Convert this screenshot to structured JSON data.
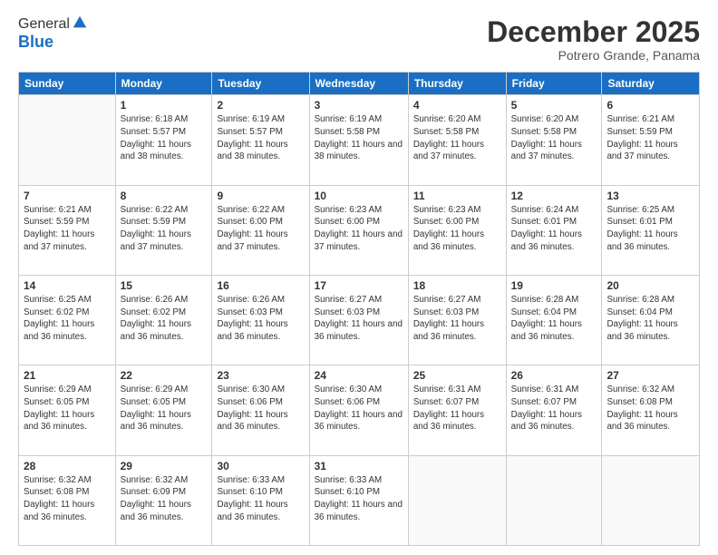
{
  "logo": {
    "general": "General",
    "blue": "Blue"
  },
  "header": {
    "month": "December 2025",
    "location": "Potrero Grande, Panama"
  },
  "days_of_week": [
    "Sunday",
    "Monday",
    "Tuesday",
    "Wednesday",
    "Thursday",
    "Friday",
    "Saturday"
  ],
  "weeks": [
    [
      {
        "day": "",
        "sunrise": "",
        "sunset": "",
        "daylight": ""
      },
      {
        "day": "1",
        "sunrise": "Sunrise: 6:18 AM",
        "sunset": "Sunset: 5:57 PM",
        "daylight": "Daylight: 11 hours and 38 minutes."
      },
      {
        "day": "2",
        "sunrise": "Sunrise: 6:19 AM",
        "sunset": "Sunset: 5:57 PM",
        "daylight": "Daylight: 11 hours and 38 minutes."
      },
      {
        "day": "3",
        "sunrise": "Sunrise: 6:19 AM",
        "sunset": "Sunset: 5:58 PM",
        "daylight": "Daylight: 11 hours and 38 minutes."
      },
      {
        "day": "4",
        "sunrise": "Sunrise: 6:20 AM",
        "sunset": "Sunset: 5:58 PM",
        "daylight": "Daylight: 11 hours and 37 minutes."
      },
      {
        "day": "5",
        "sunrise": "Sunrise: 6:20 AM",
        "sunset": "Sunset: 5:58 PM",
        "daylight": "Daylight: 11 hours and 37 minutes."
      },
      {
        "day": "6",
        "sunrise": "Sunrise: 6:21 AM",
        "sunset": "Sunset: 5:59 PM",
        "daylight": "Daylight: 11 hours and 37 minutes."
      }
    ],
    [
      {
        "day": "7",
        "sunrise": "Sunrise: 6:21 AM",
        "sunset": "Sunset: 5:59 PM",
        "daylight": "Daylight: 11 hours and 37 minutes."
      },
      {
        "day": "8",
        "sunrise": "Sunrise: 6:22 AM",
        "sunset": "Sunset: 5:59 PM",
        "daylight": "Daylight: 11 hours and 37 minutes."
      },
      {
        "day": "9",
        "sunrise": "Sunrise: 6:22 AM",
        "sunset": "Sunset: 6:00 PM",
        "daylight": "Daylight: 11 hours and 37 minutes."
      },
      {
        "day": "10",
        "sunrise": "Sunrise: 6:23 AM",
        "sunset": "Sunset: 6:00 PM",
        "daylight": "Daylight: 11 hours and 37 minutes."
      },
      {
        "day": "11",
        "sunrise": "Sunrise: 6:23 AM",
        "sunset": "Sunset: 6:00 PM",
        "daylight": "Daylight: 11 hours and 36 minutes."
      },
      {
        "day": "12",
        "sunrise": "Sunrise: 6:24 AM",
        "sunset": "Sunset: 6:01 PM",
        "daylight": "Daylight: 11 hours and 36 minutes."
      },
      {
        "day": "13",
        "sunrise": "Sunrise: 6:25 AM",
        "sunset": "Sunset: 6:01 PM",
        "daylight": "Daylight: 11 hours and 36 minutes."
      }
    ],
    [
      {
        "day": "14",
        "sunrise": "Sunrise: 6:25 AM",
        "sunset": "Sunset: 6:02 PM",
        "daylight": "Daylight: 11 hours and 36 minutes."
      },
      {
        "day": "15",
        "sunrise": "Sunrise: 6:26 AM",
        "sunset": "Sunset: 6:02 PM",
        "daylight": "Daylight: 11 hours and 36 minutes."
      },
      {
        "day": "16",
        "sunrise": "Sunrise: 6:26 AM",
        "sunset": "Sunset: 6:03 PM",
        "daylight": "Daylight: 11 hours and 36 minutes."
      },
      {
        "day": "17",
        "sunrise": "Sunrise: 6:27 AM",
        "sunset": "Sunset: 6:03 PM",
        "daylight": "Daylight: 11 hours and 36 minutes."
      },
      {
        "day": "18",
        "sunrise": "Sunrise: 6:27 AM",
        "sunset": "Sunset: 6:03 PM",
        "daylight": "Daylight: 11 hours and 36 minutes."
      },
      {
        "day": "19",
        "sunrise": "Sunrise: 6:28 AM",
        "sunset": "Sunset: 6:04 PM",
        "daylight": "Daylight: 11 hours and 36 minutes."
      },
      {
        "day": "20",
        "sunrise": "Sunrise: 6:28 AM",
        "sunset": "Sunset: 6:04 PM",
        "daylight": "Daylight: 11 hours and 36 minutes."
      }
    ],
    [
      {
        "day": "21",
        "sunrise": "Sunrise: 6:29 AM",
        "sunset": "Sunset: 6:05 PM",
        "daylight": "Daylight: 11 hours and 36 minutes."
      },
      {
        "day": "22",
        "sunrise": "Sunrise: 6:29 AM",
        "sunset": "Sunset: 6:05 PM",
        "daylight": "Daylight: 11 hours and 36 minutes."
      },
      {
        "day": "23",
        "sunrise": "Sunrise: 6:30 AM",
        "sunset": "Sunset: 6:06 PM",
        "daylight": "Daylight: 11 hours and 36 minutes."
      },
      {
        "day": "24",
        "sunrise": "Sunrise: 6:30 AM",
        "sunset": "Sunset: 6:06 PM",
        "daylight": "Daylight: 11 hours and 36 minutes."
      },
      {
        "day": "25",
        "sunrise": "Sunrise: 6:31 AM",
        "sunset": "Sunset: 6:07 PM",
        "daylight": "Daylight: 11 hours and 36 minutes."
      },
      {
        "day": "26",
        "sunrise": "Sunrise: 6:31 AM",
        "sunset": "Sunset: 6:07 PM",
        "daylight": "Daylight: 11 hours and 36 minutes."
      },
      {
        "day": "27",
        "sunrise": "Sunrise: 6:32 AM",
        "sunset": "Sunset: 6:08 PM",
        "daylight": "Daylight: 11 hours and 36 minutes."
      }
    ],
    [
      {
        "day": "28",
        "sunrise": "Sunrise: 6:32 AM",
        "sunset": "Sunset: 6:08 PM",
        "daylight": "Daylight: 11 hours and 36 minutes."
      },
      {
        "day": "29",
        "sunrise": "Sunrise: 6:32 AM",
        "sunset": "Sunset: 6:09 PM",
        "daylight": "Daylight: 11 hours and 36 minutes."
      },
      {
        "day": "30",
        "sunrise": "Sunrise: 6:33 AM",
        "sunset": "Sunset: 6:10 PM",
        "daylight": "Daylight: 11 hours and 36 minutes."
      },
      {
        "day": "31",
        "sunrise": "Sunrise: 6:33 AM",
        "sunset": "Sunset: 6:10 PM",
        "daylight": "Daylight: 11 hours and 36 minutes."
      },
      {
        "day": "",
        "sunrise": "",
        "sunset": "",
        "daylight": ""
      },
      {
        "day": "",
        "sunrise": "",
        "sunset": "",
        "daylight": ""
      },
      {
        "day": "",
        "sunrise": "",
        "sunset": "",
        "daylight": ""
      }
    ]
  ]
}
